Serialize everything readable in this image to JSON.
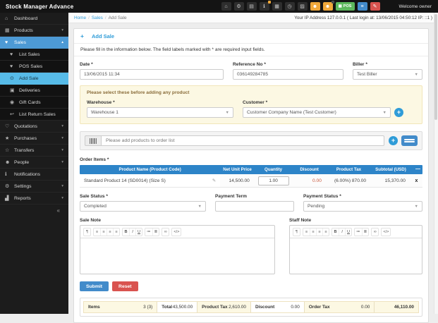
{
  "colors": {
    "topbar_bg": "#141414",
    "sidebar_bg": "#1C1C1C",
    "sidebar_active": "#4D9AD5",
    "sidebar_current": "#57BBE8",
    "accent": "#2F9CD8",
    "primary": "#428BCA",
    "success": "#5CB85C",
    "danger": "#D9534F",
    "orange": "#F0A83A",
    "table_header": "#2D84C8",
    "notice_bg": "#FCF8E3",
    "notice_text": "#8A6D3B",
    "discount": "#C9573B"
  },
  "topbar": {
    "title": "Stock Manager Advance",
    "welcome": "Welcome owner",
    "icons": [
      {
        "name": "home-icon",
        "glyph": "⌂"
      },
      {
        "name": "cogs-icon",
        "glyph": "⚙"
      },
      {
        "name": "calculator-icon",
        "glyph": "▤"
      },
      {
        "name": "info-icon",
        "glyph": "ℹ"
      },
      {
        "name": "calendar-icon",
        "glyph": "▦"
      },
      {
        "name": "clock-icon",
        "glyph": "◷"
      },
      {
        "name": "image-icon",
        "glyph": "▨"
      },
      {
        "name": "user-icon",
        "glyph": "☻"
      },
      {
        "name": "user-plus-icon",
        "glyph": "☻"
      },
      {
        "name": "pos-button",
        "glyph": "▦",
        "label": "POS"
      },
      {
        "name": "list-icon",
        "glyph": "≡"
      },
      {
        "name": "pencil-icon",
        "glyph": "✎"
      }
    ]
  },
  "breadcrumb": {
    "home": "Home",
    "sales": "Sales",
    "current": "Add Sale",
    "ip": "Your IP Address 127.0.0.1 ( Last login at: 13/06/2015 04:50:12 IP: ::1 )"
  },
  "sidebar": {
    "items": [
      {
        "label": "Dashboard",
        "glyph": "⌂"
      },
      {
        "label": "Products",
        "glyph": "▦"
      },
      {
        "label": "Sales",
        "glyph": "♥"
      },
      {
        "label": "List Sales",
        "glyph": "♥"
      },
      {
        "label": "POS Sales",
        "glyph": "♥"
      },
      {
        "label": "Add Sale",
        "glyph": "⊙"
      },
      {
        "label": "Deliveries",
        "glyph": "▣"
      },
      {
        "label": "Gift Cards",
        "glyph": "◉"
      },
      {
        "label": "List Return Sales",
        "glyph": "↩"
      },
      {
        "label": "Quotations",
        "glyph": "♡"
      },
      {
        "label": "Purchases",
        "glyph": "★"
      },
      {
        "label": "Transfers",
        "glyph": "☆"
      },
      {
        "label": "People",
        "glyph": "☻"
      },
      {
        "label": "Notifications",
        "glyph": "ℹ"
      },
      {
        "label": "Settings",
        "glyph": "⚙"
      },
      {
        "label": "Reports",
        "glyph": "▟"
      }
    ],
    "collapse": "«"
  },
  "panel": {
    "title": "Add Sale",
    "plus": "+",
    "description": "Please fill in the information below. The field labels marked with * are required input fields."
  },
  "form": {
    "date": {
      "label": "Date *",
      "value": "13/06/2015 11:34"
    },
    "reference": {
      "label": "Reference No *",
      "value": "036149284785"
    },
    "biller": {
      "label": "Biller *",
      "value": "Test Biller"
    },
    "notice": "Please select these before adding any product",
    "warehouse": {
      "label": "Warehouse *",
      "value": "Warehouse 1"
    },
    "customer": {
      "label": "Customer *",
      "value": "Customer Company Name (Test Customer)"
    },
    "search_placeholder": "Please add products to order list",
    "order_items": {
      "label": "Order Items *",
      "columns": [
        "Product Name (Product Code)",
        "Net Unit Price",
        "Quantity",
        "Discount",
        "Product Tax",
        "Subtotal (USD)"
      ],
      "rows": [
        {
          "product": "Standard Product 14 (SD0014) (Size S)",
          "price": "14,500.00",
          "quantity": "1.00",
          "discount": "0.00",
          "tax": "(6.00%) 870.00",
          "subtotal": "15,370.00",
          "remove": "x"
        }
      ]
    },
    "sale_status": {
      "label": "Sale Status *",
      "value": "Completed"
    },
    "payment_term": {
      "label": "Payment Term",
      "value": ""
    },
    "payment_status": {
      "label": "Payment Status *",
      "value": "Pending"
    },
    "sale_note_label": "Sale Note",
    "staff_note_label": "Staff Note",
    "editor_toolbar": [
      {
        "name": "paragraph",
        "glyph": "¶"
      },
      {
        "name": "align-left",
        "glyph": "≡"
      },
      {
        "name": "align-center",
        "glyph": "≡"
      },
      {
        "name": "align-right",
        "glyph": "≡"
      },
      {
        "name": "align-justify",
        "glyph": "≡"
      },
      {
        "name": "bold",
        "glyph": "B"
      },
      {
        "name": "italic",
        "glyph": "I"
      },
      {
        "name": "underline",
        "glyph": "U"
      },
      {
        "name": "list-ul",
        "glyph": "≔"
      },
      {
        "name": "list-ol",
        "glyph": "≣"
      },
      {
        "name": "link",
        "glyph": "∞"
      },
      {
        "name": "code",
        "glyph": "</>"
      }
    ],
    "submit": "Submit",
    "reset": "Reset",
    "totals": {
      "items_label": "Items",
      "items_value": "3 (3)",
      "total_label": "Total",
      "total_value": "43,500.00",
      "product_tax_label": "Product Tax",
      "product_tax_value": "2,610.00",
      "discount_label": "Discount",
      "discount_value": "0.00",
      "order_tax_label": "Order Tax",
      "order_tax_value": "0.00",
      "grand_total": "46,110.00"
    }
  }
}
